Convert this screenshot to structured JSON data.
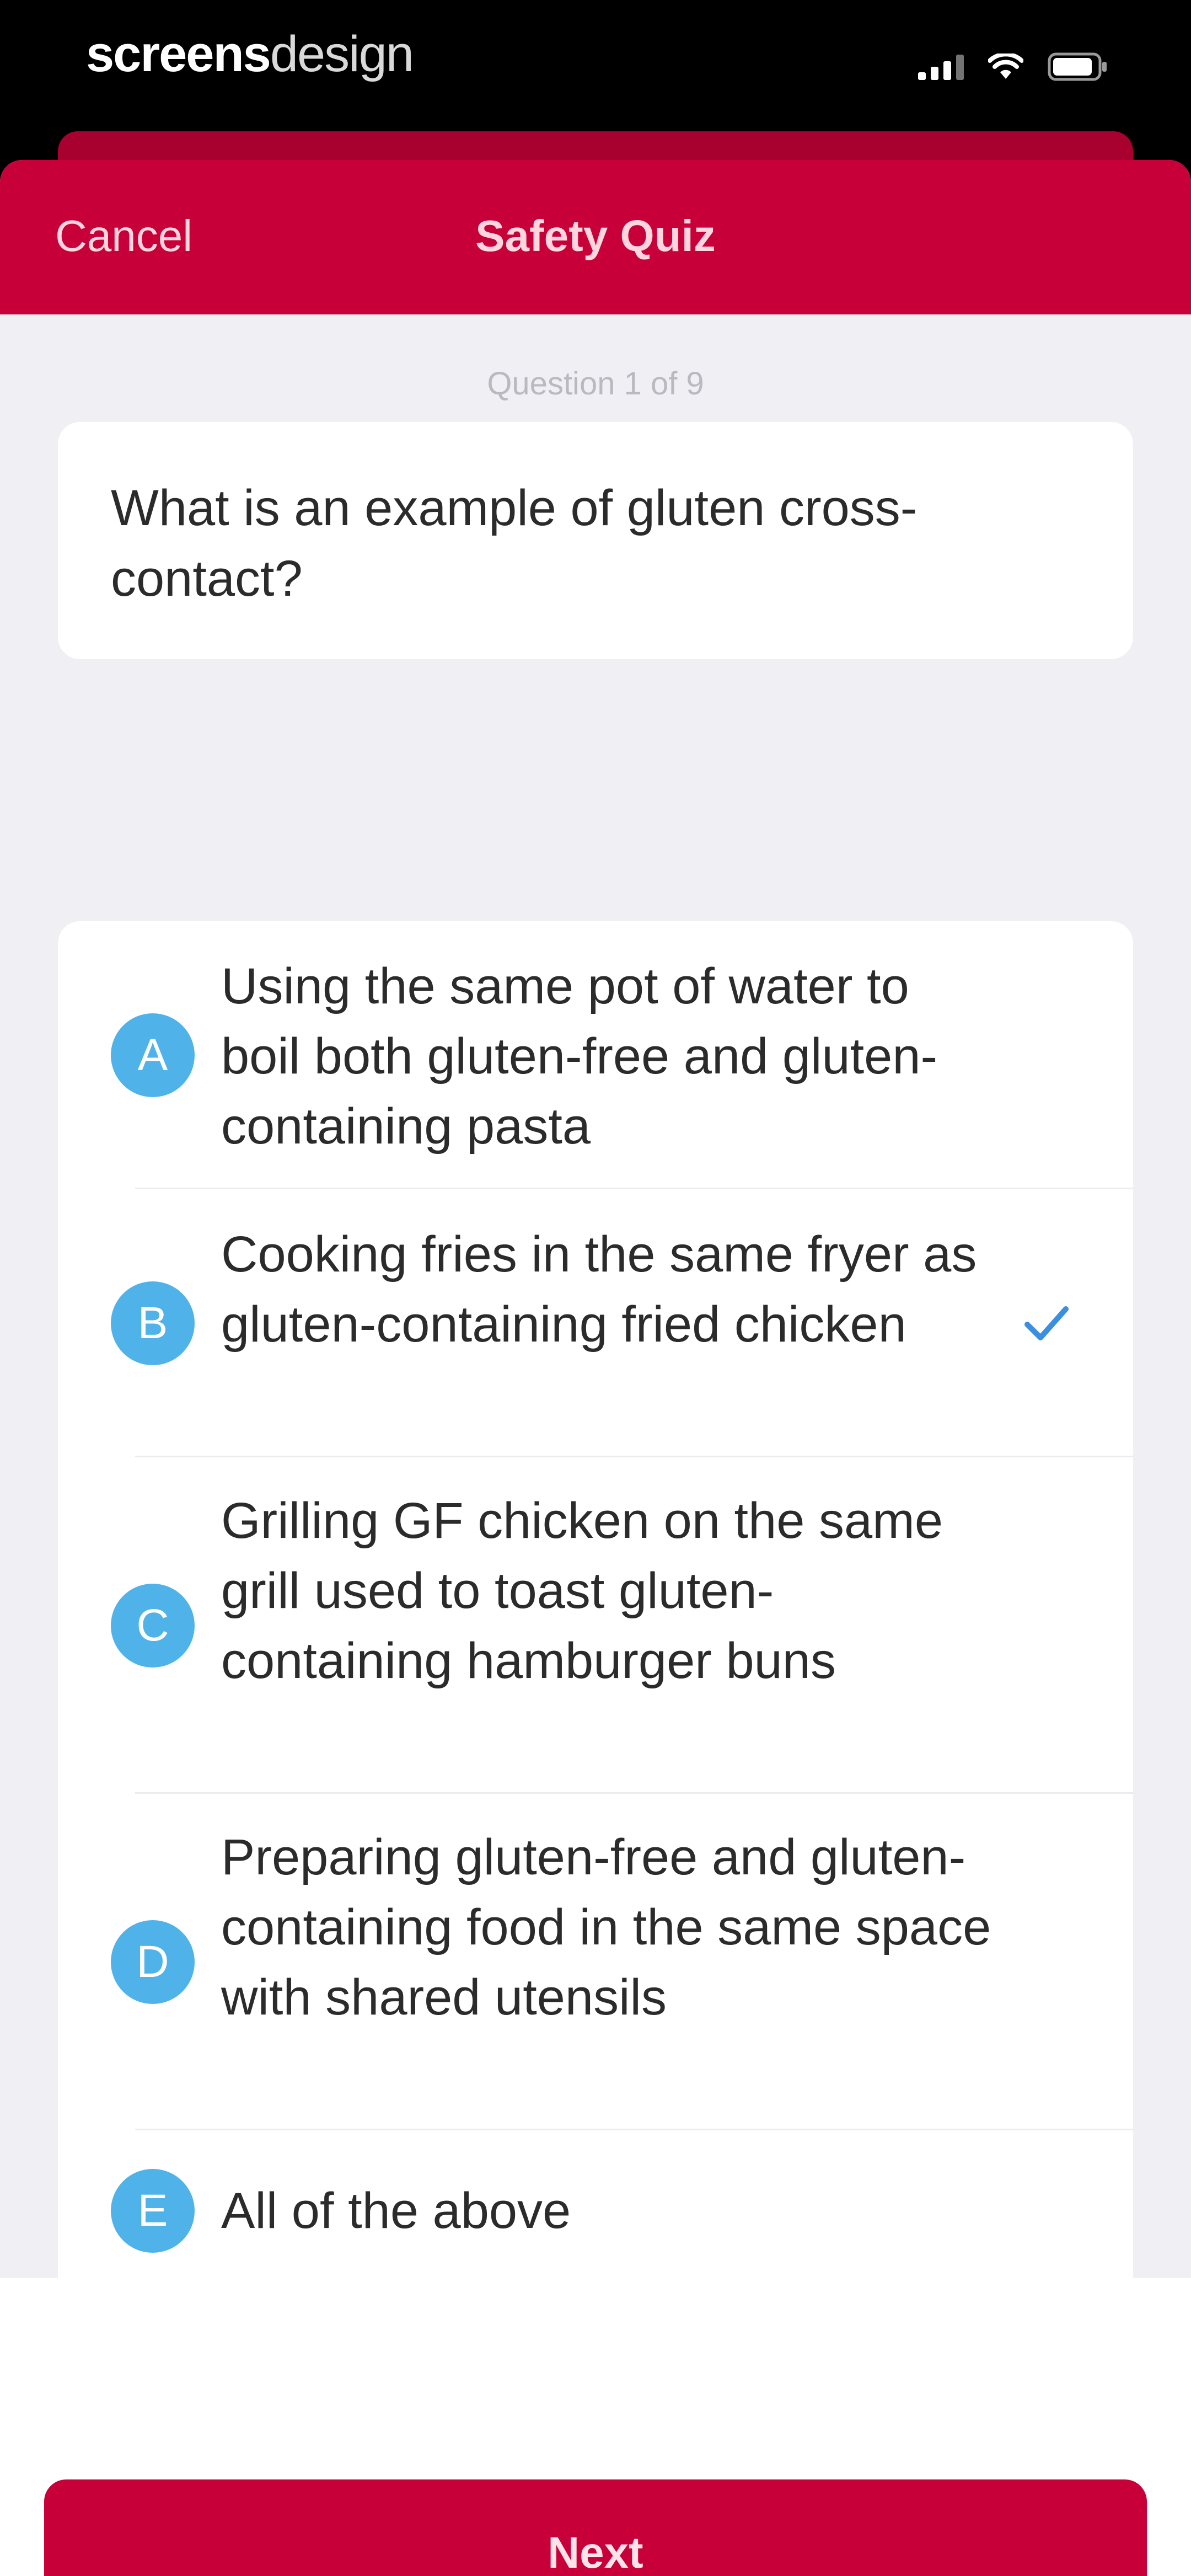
{
  "status_bar": {
    "brand_bold": "screens",
    "brand_light": "design",
    "icons": [
      "signal-icon",
      "wifi-icon",
      "battery-icon"
    ]
  },
  "nav": {
    "cancel_label": "Cancel",
    "title": "Safety Quiz"
  },
  "quiz": {
    "counter": "Question 1 of 9",
    "question": "What is an example of gluten cross-contact?",
    "answers": [
      {
        "letter": "A",
        "text": "Using the same pot of water to boil both gluten-free and gluten-containing pasta",
        "selected": false
      },
      {
        "letter": "B",
        "text": "Cooking fries in the same fryer as gluten-containing fried chicken",
        "selected": true
      },
      {
        "letter": "C",
        "text": "Grilling GF chicken on the same grill used to toast gluten-containing hamburger buns",
        "selected": false
      },
      {
        "letter": "D",
        "text": "Preparing gluten-free and gluten-containing food in the same space with shared utensils",
        "selected": false
      },
      {
        "letter": "E",
        "text": "All of the above",
        "selected": false
      }
    ]
  },
  "footer": {
    "next_label": "Next"
  },
  "colors": {
    "brand_red": "#c8003a",
    "badge_blue": "#4fb3ea",
    "check_blue": "#3b8fe0",
    "background": "#efeff4"
  }
}
